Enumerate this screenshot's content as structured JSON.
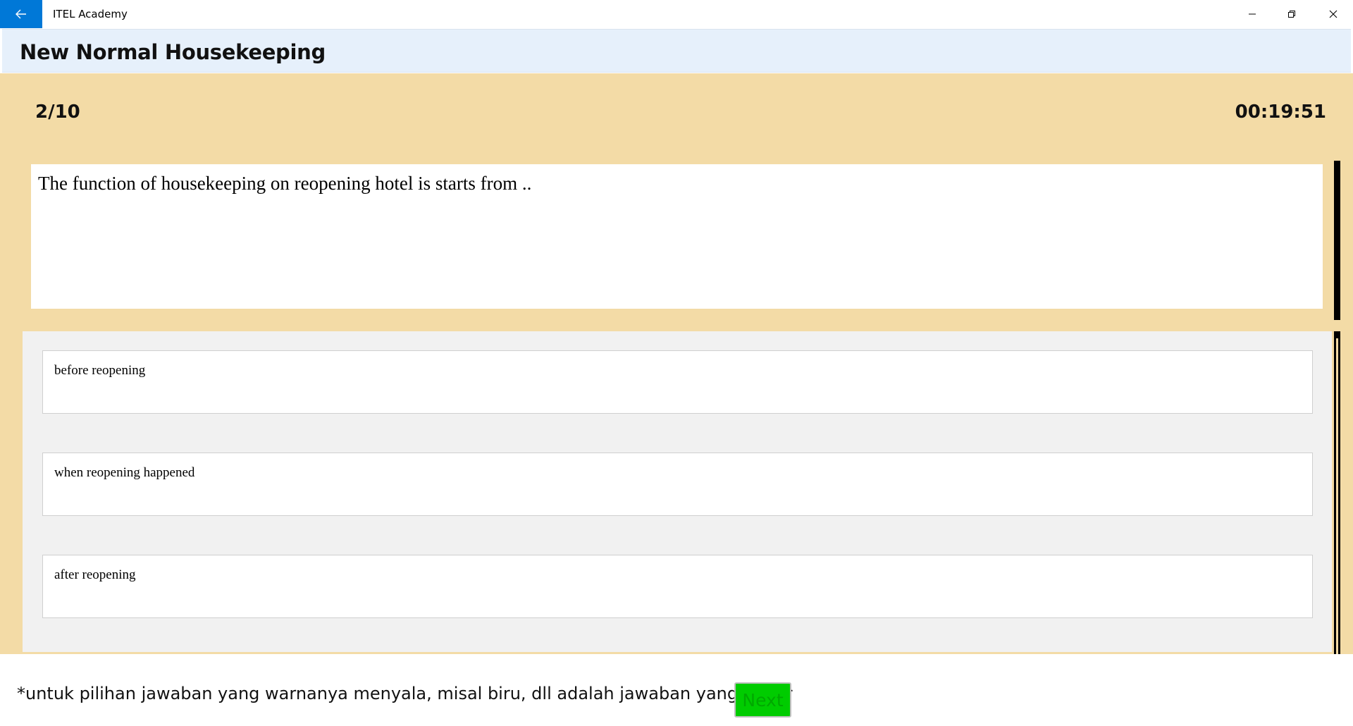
{
  "window": {
    "title": "ITEL Academy",
    "back_icon": "arrow-left-icon",
    "accent_color": "#0078d7",
    "controls": [
      "minimize-icon",
      "restore-icon",
      "close-icon"
    ]
  },
  "header": {
    "title": "New Normal Housekeeping",
    "background": "#e6f0fb"
  },
  "quiz": {
    "progress": "2/10",
    "timer": "00:19:51",
    "background": "#f3dba6",
    "question": "The function of housekeeping on reopening hotel is starts from ..",
    "answers": [
      {
        "label": "before reopening"
      },
      {
        "label": "when reopening happened"
      },
      {
        "label": "after reopening"
      }
    ]
  },
  "footer": {
    "note": "*untuk pilihan jawaban yang warnanya menyala, misal biru, dll adalah jawaban yang benar",
    "next_label": "Next",
    "next_color": "#00cc00"
  }
}
